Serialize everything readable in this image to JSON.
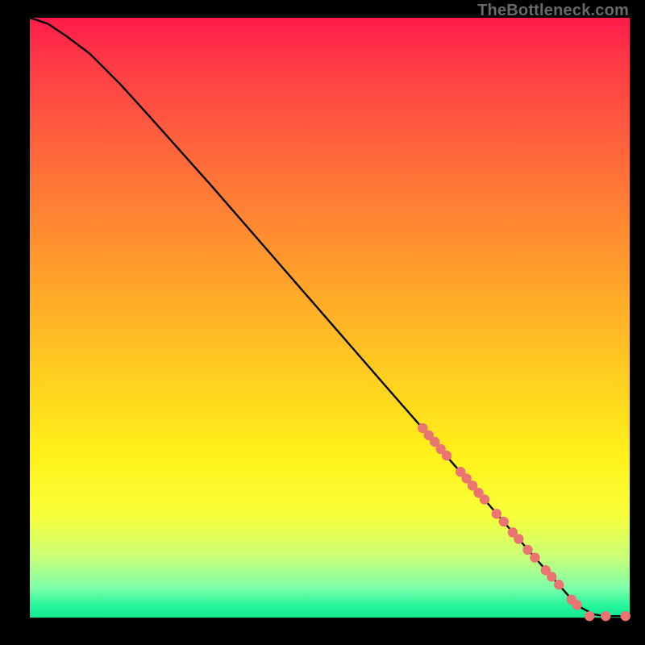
{
  "watermark": "TheBottleneck.com",
  "colors": {
    "line": "#000000",
    "marker": "#e97471",
    "background_black": "#000000"
  },
  "chart_data": {
    "type": "line",
    "title": "",
    "xlabel": "",
    "ylabel": "",
    "xlim": [
      0,
      100
    ],
    "ylim": [
      0,
      100
    ],
    "grid": false,
    "legend": false,
    "series": [
      {
        "name": "curve",
        "x": [
          0,
          3,
          6,
          10,
          15,
          20,
          30,
          40,
          50,
          60,
          65,
          70,
          75,
          80,
          85,
          88,
          90,
          92,
          94,
          96,
          98,
          100
        ],
        "y": [
          100,
          99,
          97,
          94,
          89,
          83.5,
          72.3,
          60.8,
          49.3,
          37.8,
          32.1,
          26.3,
          20.6,
          14.8,
          9.1,
          5.7,
          3.4,
          1.6,
          0.55,
          0.22,
          0.25,
          0.25
        ]
      }
    ],
    "markers": [
      {
        "x": 65.5,
        "y": 31.6
      },
      {
        "x": 66.5,
        "y": 30.4
      },
      {
        "x": 67.5,
        "y": 29.3
      },
      {
        "x": 68.5,
        "y": 28.1
      },
      {
        "x": 69.5,
        "y": 27.0
      },
      {
        "x": 71.8,
        "y": 24.3
      },
      {
        "x": 72.8,
        "y": 23.2
      },
      {
        "x": 73.8,
        "y": 22.0
      },
      {
        "x": 74.8,
        "y": 20.8
      },
      {
        "x": 75.8,
        "y": 19.7
      },
      {
        "x": 77.8,
        "y": 17.3
      },
      {
        "x": 79.0,
        "y": 16.0
      },
      {
        "x": 80.5,
        "y": 14.2
      },
      {
        "x": 81.5,
        "y": 13.1
      },
      {
        "x": 83.0,
        "y": 11.3
      },
      {
        "x": 84.2,
        "y": 10.0
      },
      {
        "x": 86.0,
        "y": 7.9
      },
      {
        "x": 87.0,
        "y": 6.8
      },
      {
        "x": 88.2,
        "y": 5.5
      },
      {
        "x": 90.3,
        "y": 3.0
      },
      {
        "x": 91.2,
        "y": 2.1
      },
      {
        "x": 93.3,
        "y": 0.25
      },
      {
        "x": 96.0,
        "y": 0.25
      },
      {
        "x": 99.3,
        "y": 0.25
      }
    ]
  }
}
